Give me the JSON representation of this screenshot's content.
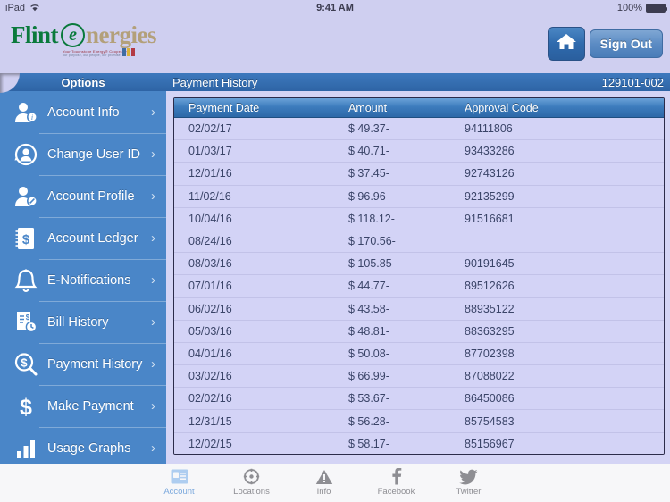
{
  "status_bar": {
    "device": "iPad",
    "wifi_icon": "wifi-icon",
    "time": "9:41 AM",
    "battery_percent": "100%",
    "battery_icon": "battery-full-icon"
  },
  "brand": {
    "logo_word1": "Flint",
    "logo_circle_letter": "e",
    "logo_word2": "nergies",
    "tagline": "Your Touchstone Energy® Cooperative",
    "tagline2": "our purpose, our people, our promise",
    "colors": {
      "green": "#0a7a3c",
      "tan": "#b3a07a"
    }
  },
  "header_buttons": {
    "home_icon": "home-icon",
    "sign_out_label": "Sign Out"
  },
  "sidebar": {
    "title": "Options",
    "items": [
      {
        "label": "Account Info",
        "icon": "person-info-icon",
        "chevron": "›"
      },
      {
        "label": "Change User ID",
        "icon": "person-refresh-icon",
        "chevron": "›"
      },
      {
        "label": "Account Profile",
        "icon": "person-edit-icon",
        "chevron": "›"
      },
      {
        "label": "Account Ledger",
        "icon": "ledger-dollar-icon",
        "chevron": "›"
      },
      {
        "label": "E-Notifications",
        "icon": "bell-icon",
        "chevron": "›"
      },
      {
        "label": "Bill History",
        "icon": "bill-clock-icon",
        "chevron": "›"
      },
      {
        "label": "Payment History",
        "icon": "magnifier-dollar-icon",
        "chevron": "›"
      },
      {
        "label": "Make Payment",
        "icon": "dollar-sign-icon",
        "chevron": "›"
      },
      {
        "label": "Usage Graphs",
        "icon": "bar-chart-icon",
        "chevron": "›"
      }
    ]
  },
  "main": {
    "title": "Payment History",
    "account_number": "129101-002",
    "table": {
      "columns": [
        "Payment Date",
        "Amount",
        "Approval Code"
      ],
      "rows": [
        [
          "02/02/17",
          "$ 49.37-",
          "94111806"
        ],
        [
          "01/03/17",
          "$ 40.71-",
          "93433286"
        ],
        [
          "12/01/16",
          "$ 37.45-",
          "92743126"
        ],
        [
          "11/02/16",
          "$ 96.96-",
          "92135299"
        ],
        [
          "10/04/16",
          "$ 118.12-",
          "91516681"
        ],
        [
          "08/24/16",
          "$ 170.56-",
          ""
        ],
        [
          "08/03/16",
          "$ 105.85-",
          "90191645"
        ],
        [
          "07/01/16",
          "$ 44.77-",
          "89512626"
        ],
        [
          "06/02/16",
          "$ 43.58-",
          "88935122"
        ],
        [
          "05/03/16",
          "$ 48.81-",
          "88363295"
        ],
        [
          "04/01/16",
          "$ 50.08-",
          "87702398"
        ],
        [
          "03/02/16",
          "$ 66.99-",
          "87088022"
        ],
        [
          "02/02/16",
          "$ 53.67-",
          "86450086"
        ],
        [
          "12/31/15",
          "$ 56.28-",
          "85754583"
        ],
        [
          "12/02/15",
          "$ 58.17-",
          "85156967"
        ]
      ]
    }
  },
  "tabbar": {
    "tabs": [
      {
        "label": "Account",
        "icon": "account-card-icon",
        "selected": true
      },
      {
        "label": "Locations",
        "icon": "compass-icon",
        "selected": false
      },
      {
        "label": "Info",
        "icon": "warning-icon",
        "selected": false
      },
      {
        "label": "Facebook",
        "icon": "facebook-icon",
        "selected": false
      },
      {
        "label": "Twitter",
        "icon": "twitter-icon",
        "selected": false
      }
    ],
    "selected_color": "#7aa8dd"
  }
}
